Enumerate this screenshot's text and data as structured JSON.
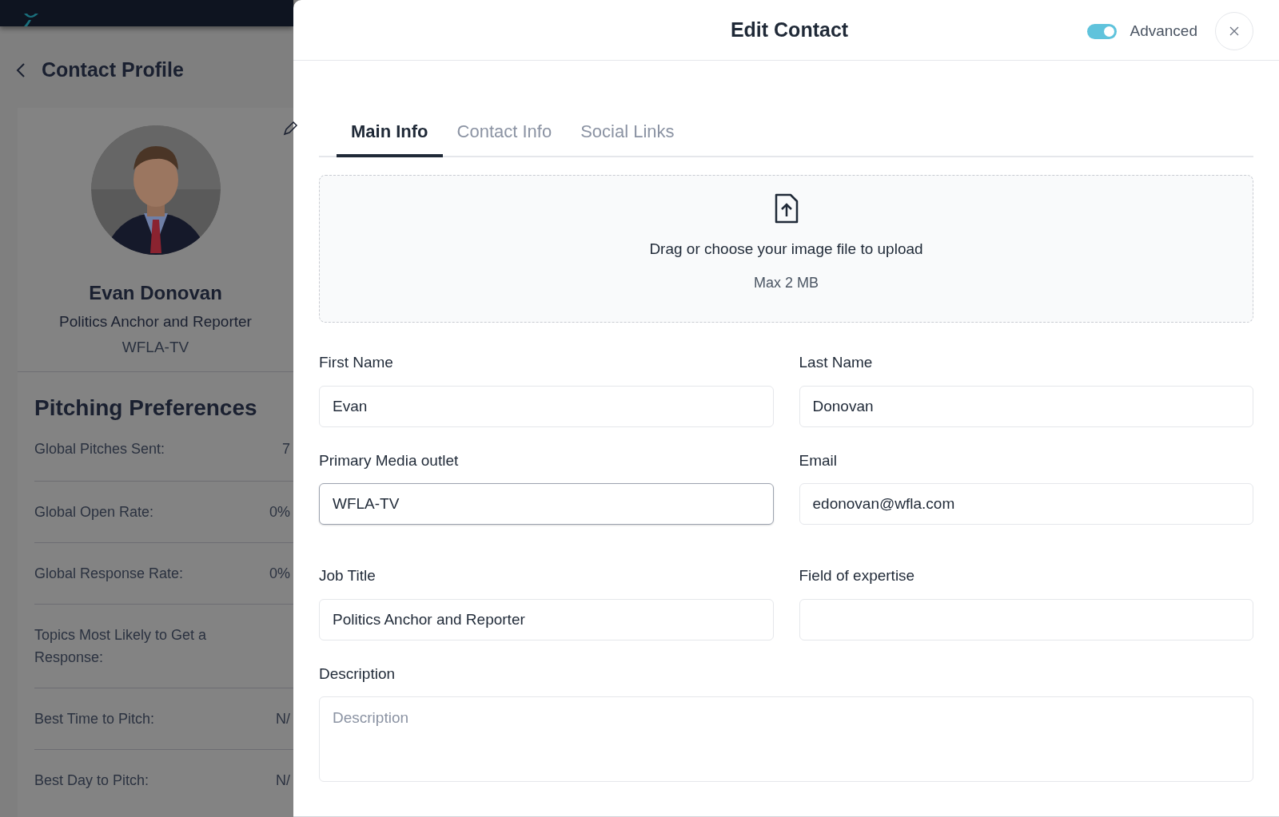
{
  "page": {
    "title": "Contact Profile"
  },
  "profile": {
    "name": "Evan Donovan",
    "job_title": "Politics Anchor and Reporter",
    "outlet": "WFLA-TV"
  },
  "pitching": {
    "title": "Pitching Preferences",
    "rows": [
      {
        "label": "Global Pitches Sent:",
        "value": "7"
      },
      {
        "label": "Global Open Rate:",
        "value": "0%"
      },
      {
        "label": "Global Response Rate:",
        "value": "0%"
      },
      {
        "label": "Topics Most Likely to Get a Response:"
      },
      {
        "label": "Best Time to Pitch:",
        "value": "N/"
      },
      {
        "label": "Best Day to Pitch:",
        "value": "N/"
      }
    ]
  },
  "modal": {
    "title": "Edit Contact",
    "advanced": {
      "label": "Advanced",
      "on": true
    },
    "tabs": [
      {
        "label": "Main Info",
        "selected": true
      },
      {
        "label": "Contact Info",
        "selected": false
      },
      {
        "label": "Social Links",
        "selected": false
      }
    ],
    "upload": {
      "text": "Drag or choose your image file to upload",
      "hint": "Max 2 MB"
    },
    "fields": [
      {
        "label": "First Name",
        "value": "Evan",
        "focused": false
      },
      {
        "label": "Last Name",
        "value": "Donovan",
        "focused": false
      },
      {
        "label": "Primary Media outlet",
        "value": "WFLA-TV",
        "focused": true
      },
      {
        "label": "Email",
        "value": "edonovan@wfla.com",
        "focused": false
      },
      {
        "label": "Job Title",
        "value": "Politics Anchor and Reporter",
        "focused": false
      },
      {
        "label": "Field of expertise",
        "focused": false
      }
    ],
    "description": {
      "label": "Description",
      "placeholder": "Description"
    }
  }
}
